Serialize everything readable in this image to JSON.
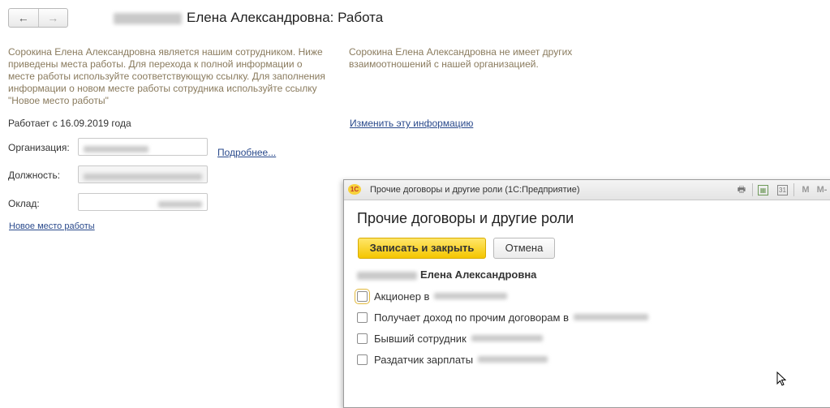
{
  "nav": {
    "back": "←",
    "forward": "→"
  },
  "header": {
    "title": "Елена Александровна: Работа"
  },
  "left_info": "Сорокина Елена Александровна является нашим сотрудником. Ниже приведены места работы. Для перехода к полной информации о месте работы используйте соответствующую ссылку. Для заполнения информации о новом месте работы сотрудника используйте ссылку \"Новое место работы\"",
  "works_since": "Работает с 16.09.2019 года",
  "fields": {
    "organization_label": "Организация:",
    "position_label": "Должность:",
    "salary_label": "Оклад:"
  },
  "details_link": "Подробнее...",
  "new_work_link": "Новое место работы",
  "right_info": "Сорокина Елена Александровна не имеет других взаимоотношений с нашей организацией.",
  "change_link": "Изменить эту информацию",
  "dialog": {
    "window_title": "Прочие договоры и другие роли  (1С:Предприятие)",
    "heading": "Прочие договоры и другие роли",
    "save_close": "Записать и закрыть",
    "cancel": "Отмена",
    "person": "Елена Александровна",
    "checkboxes": [
      {
        "label": "Акционер в",
        "checked": false
      },
      {
        "label": "Получает доход по прочим договорам в",
        "checked": false
      },
      {
        "label": "Бывший сотрудник",
        "checked": false
      },
      {
        "label": "Раздатчик зарплаты",
        "checked": false
      }
    ],
    "toolbar_icons": [
      "print-icon",
      "table-icon",
      "calendar-icon",
      "memory-icon",
      "memory-minus-icon"
    ]
  }
}
